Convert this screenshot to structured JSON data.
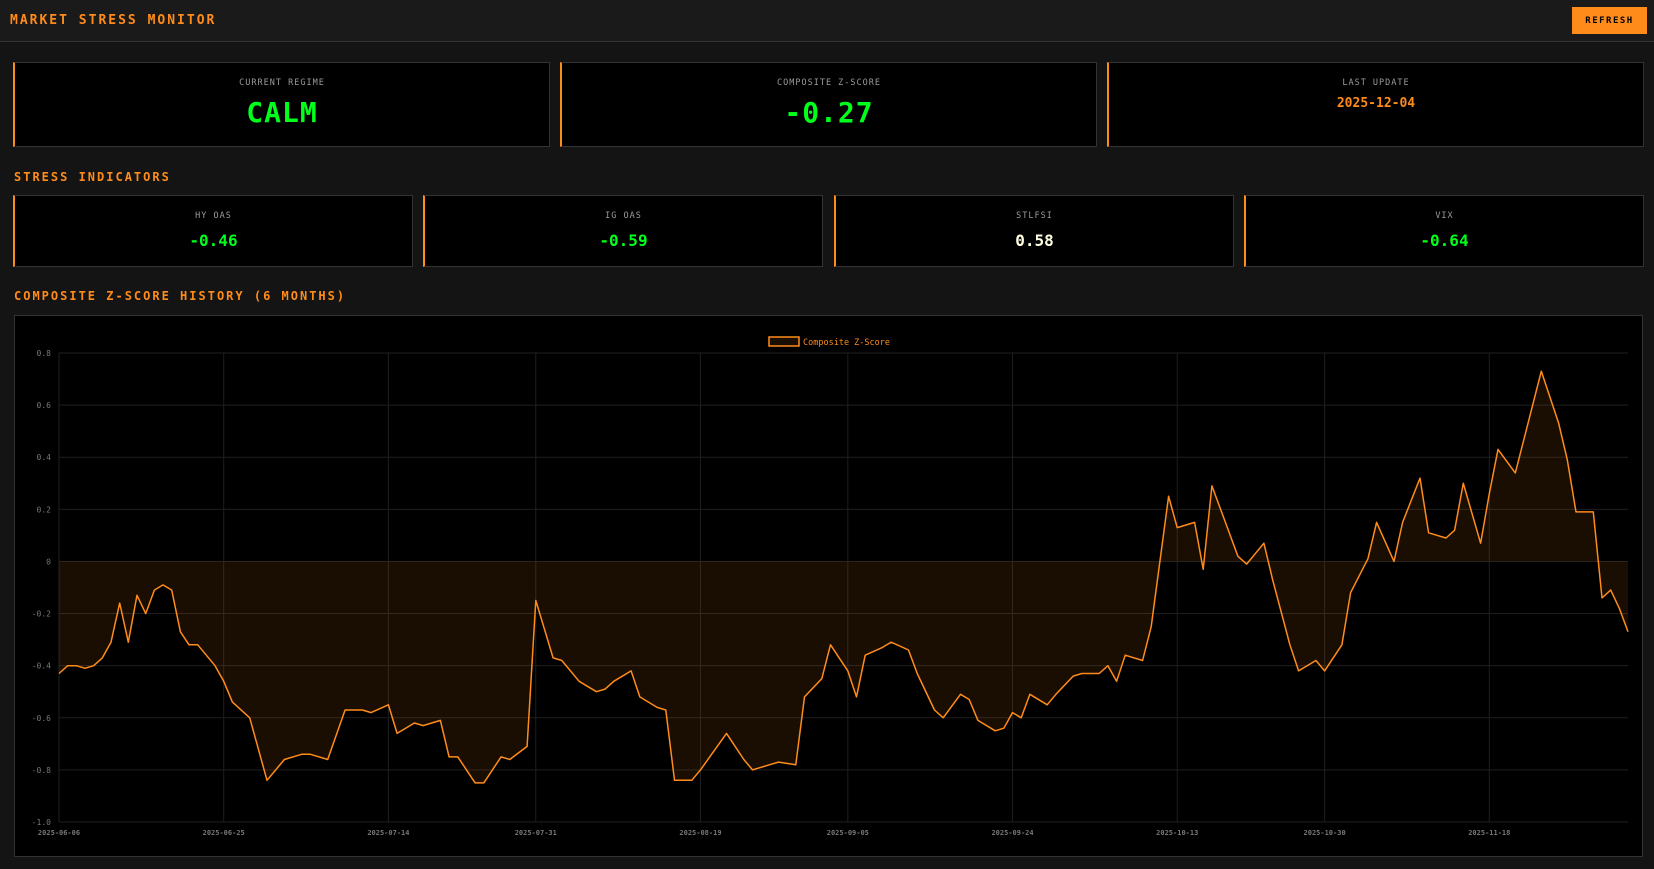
{
  "header": {
    "title": "MARKET STRESS MONITOR",
    "refresh_label": "REFRESH"
  },
  "summary": {
    "regime_label": "CURRENT REGIME",
    "regime_value": "CALM",
    "zscore_label": "COMPOSITE Z-SCORE",
    "zscore_value": "-0.27",
    "update_label": "LAST UPDATE",
    "update_value": "2025-12-04"
  },
  "indicators": {
    "section_title": "STRESS INDICATORS",
    "items": [
      {
        "label": "HY OAS",
        "value": "-0.46",
        "color": "#00ff1a"
      },
      {
        "label": "IG OAS",
        "value": "-0.59",
        "color": "#00ff1a"
      },
      {
        "label": "STLFSI",
        "value": "0.58",
        "color": "#fffde0"
      },
      {
        "label": "VIX",
        "value": "-0.64",
        "color": "#00ff1a"
      }
    ]
  },
  "history": {
    "section_title": "COMPOSITE Z-SCORE HISTORY (6 MONTHS)"
  },
  "colors": {
    "accent": "#ff8c1a",
    "positive": "#00ff1a",
    "background": "#141414",
    "panel": "#000000"
  },
  "chart_data": {
    "type": "area",
    "legend": [
      "Composite Z-Score"
    ],
    "legend_position": "top-center",
    "grid": true,
    "ylim": [
      -1.0,
      0.8
    ],
    "yticks": [
      "0.8",
      "0.6",
      "0.4",
      "0.2",
      "0",
      "-0.2",
      "-0.4",
      "-0.6",
      "-0.8",
      "-1.0"
    ],
    "xticks": [
      "2025-06-06",
      "2025-06-25",
      "2025-07-14",
      "2025-07-31",
      "2025-08-19",
      "2025-09-05",
      "2025-09-24",
      "2025-10-13",
      "2025-10-30",
      "2025-11-18"
    ],
    "xlim": [
      "2025-06-06",
      "2025-12-04"
    ],
    "series": [
      {
        "name": "Composite Z-Score",
        "color": "#ff8c1a",
        "points": [
          [
            "2025-06-06",
            -0.43
          ],
          [
            "2025-06-07",
            -0.4
          ],
          [
            "2025-06-08",
            -0.4
          ],
          [
            "2025-06-09",
            -0.41
          ],
          [
            "2025-06-10",
            -0.4
          ],
          [
            "2025-06-11",
            -0.37
          ],
          [
            "2025-06-12",
            -0.31
          ],
          [
            "2025-06-13",
            -0.16
          ],
          [
            "2025-06-14",
            -0.31
          ],
          [
            "2025-06-15",
            -0.13
          ],
          [
            "2025-06-16",
            -0.2
          ],
          [
            "2025-06-17",
            -0.11
          ],
          [
            "2025-06-18",
            -0.09
          ],
          [
            "2025-06-19",
            -0.11
          ],
          [
            "2025-06-20",
            -0.27
          ],
          [
            "2025-06-21",
            -0.32
          ],
          [
            "2025-06-22",
            -0.32
          ],
          [
            "2025-06-24",
            -0.4
          ],
          [
            "2025-06-25",
            -0.46
          ],
          [
            "2025-06-26",
            -0.54
          ],
          [
            "2025-06-28",
            -0.6
          ],
          [
            "2025-06-30",
            -0.84
          ],
          [
            "2025-07-02",
            -0.76
          ],
          [
            "2025-07-04",
            -0.74
          ],
          [
            "2025-07-05",
            -0.74
          ],
          [
            "2025-07-07",
            -0.76
          ],
          [
            "2025-07-09",
            -0.57
          ],
          [
            "2025-07-11",
            -0.57
          ],
          [
            "2025-07-12",
            -0.58
          ],
          [
            "2025-07-14",
            -0.55
          ],
          [
            "2025-07-15",
            -0.66
          ],
          [
            "2025-07-17",
            -0.62
          ],
          [
            "2025-07-18",
            -0.63
          ],
          [
            "2025-07-20",
            -0.61
          ],
          [
            "2025-07-21",
            -0.75
          ],
          [
            "2025-07-22",
            -0.75
          ],
          [
            "2025-07-24",
            -0.85
          ],
          [
            "2025-07-25",
            -0.85
          ],
          [
            "2025-07-27",
            -0.75
          ],
          [
            "2025-07-28",
            -0.76
          ],
          [
            "2025-07-30",
            -0.71
          ],
          [
            "2025-07-31",
            -0.15
          ],
          [
            "2025-08-02",
            -0.37
          ],
          [
            "2025-08-03",
            -0.38
          ],
          [
            "2025-08-05",
            -0.46
          ],
          [
            "2025-08-07",
            -0.5
          ],
          [
            "2025-08-08",
            -0.49
          ],
          [
            "2025-08-09",
            -0.46
          ],
          [
            "2025-08-11",
            -0.42
          ],
          [
            "2025-08-12",
            -0.52
          ],
          [
            "2025-08-14",
            -0.56
          ],
          [
            "2025-08-15",
            -0.57
          ],
          [
            "2025-08-16",
            -0.84
          ],
          [
            "2025-08-18",
            -0.84
          ],
          [
            "2025-08-19",
            -0.8
          ],
          [
            "2025-08-22",
            -0.66
          ],
          [
            "2025-08-24",
            -0.76
          ],
          [
            "2025-08-25",
            -0.8
          ],
          [
            "2025-08-26",
            -0.79
          ],
          [
            "2025-08-27",
            -0.78
          ],
          [
            "2025-08-28",
            -0.77
          ],
          [
            "2025-08-30",
            -0.78
          ],
          [
            "2025-08-31",
            -0.52
          ],
          [
            "2025-09-02",
            -0.45
          ],
          [
            "2025-09-03",
            -0.32
          ],
          [
            "2025-09-05",
            -0.42
          ],
          [
            "2025-09-06",
            -0.52
          ],
          [
            "2025-09-07",
            -0.36
          ],
          [
            "2025-09-09",
            -0.33
          ],
          [
            "2025-09-10",
            -0.31
          ],
          [
            "2025-09-12",
            -0.34
          ],
          [
            "2025-09-13",
            -0.43
          ],
          [
            "2025-09-15",
            -0.57
          ],
          [
            "2025-09-16",
            -0.6
          ],
          [
            "2025-09-18",
            -0.51
          ],
          [
            "2025-09-19",
            -0.53
          ],
          [
            "2025-09-20",
            -0.61
          ],
          [
            "2025-09-22",
            -0.65
          ],
          [
            "2025-09-23",
            -0.64
          ],
          [
            "2025-09-24",
            -0.58
          ],
          [
            "2025-09-25",
            -0.6
          ],
          [
            "2025-09-26",
            -0.51
          ],
          [
            "2025-09-28",
            -0.55
          ],
          [
            "2025-09-29",
            -0.51
          ],
          [
            "2025-10-01",
            -0.44
          ],
          [
            "2025-10-02",
            -0.43
          ],
          [
            "2025-10-04",
            -0.43
          ],
          [
            "2025-10-05",
            -0.4
          ],
          [
            "2025-10-06",
            -0.46
          ],
          [
            "2025-10-07",
            -0.36
          ],
          [
            "2025-10-09",
            -0.38
          ],
          [
            "2025-10-10",
            -0.25
          ],
          [
            "2025-10-12",
            0.25
          ],
          [
            "2025-10-13",
            0.13
          ],
          [
            "2025-10-15",
            0.15
          ],
          [
            "2025-10-16",
            -0.03
          ],
          [
            "2025-10-17",
            0.29
          ],
          [
            "2025-10-18",
            0.2
          ],
          [
            "2025-10-20",
            0.02
          ],
          [
            "2025-10-21",
            -0.01
          ],
          [
            "2025-10-23",
            0.07
          ],
          [
            "2025-10-24",
            -0.07
          ],
          [
            "2025-10-26",
            -0.32
          ],
          [
            "2025-10-27",
            -0.42
          ],
          [
            "2025-10-29",
            -0.38
          ],
          [
            "2025-10-30",
            -0.42
          ],
          [
            "2025-11-01",
            -0.32
          ],
          [
            "2025-11-02",
            -0.12
          ],
          [
            "2025-11-04",
            0.01
          ],
          [
            "2025-11-05",
            0.15
          ],
          [
            "2025-11-07",
            0.0
          ],
          [
            "2025-11-08",
            0.15
          ],
          [
            "2025-11-10",
            0.32
          ],
          [
            "2025-11-11",
            0.11
          ],
          [
            "2025-11-13",
            0.09
          ],
          [
            "2025-11-14",
            0.12
          ],
          [
            "2025-11-15",
            0.3
          ],
          [
            "2025-11-17",
            0.07
          ],
          [
            "2025-11-18",
            0.26
          ],
          [
            "2025-11-19",
            0.43
          ],
          [
            "2025-11-21",
            0.34
          ],
          [
            "2025-11-22",
            0.47
          ],
          [
            "2025-11-24",
            0.73
          ],
          [
            "2025-11-26",
            0.53
          ],
          [
            "2025-11-27",
            0.39
          ],
          [
            "2025-11-28",
            0.19
          ],
          [
            "2025-11-30",
            0.19
          ],
          [
            "2025-12-01",
            -0.14
          ],
          [
            "2025-12-02",
            -0.11
          ],
          [
            "2025-12-03",
            -0.18
          ],
          [
            "2025-12-04",
            -0.27
          ]
        ]
      }
    ]
  }
}
